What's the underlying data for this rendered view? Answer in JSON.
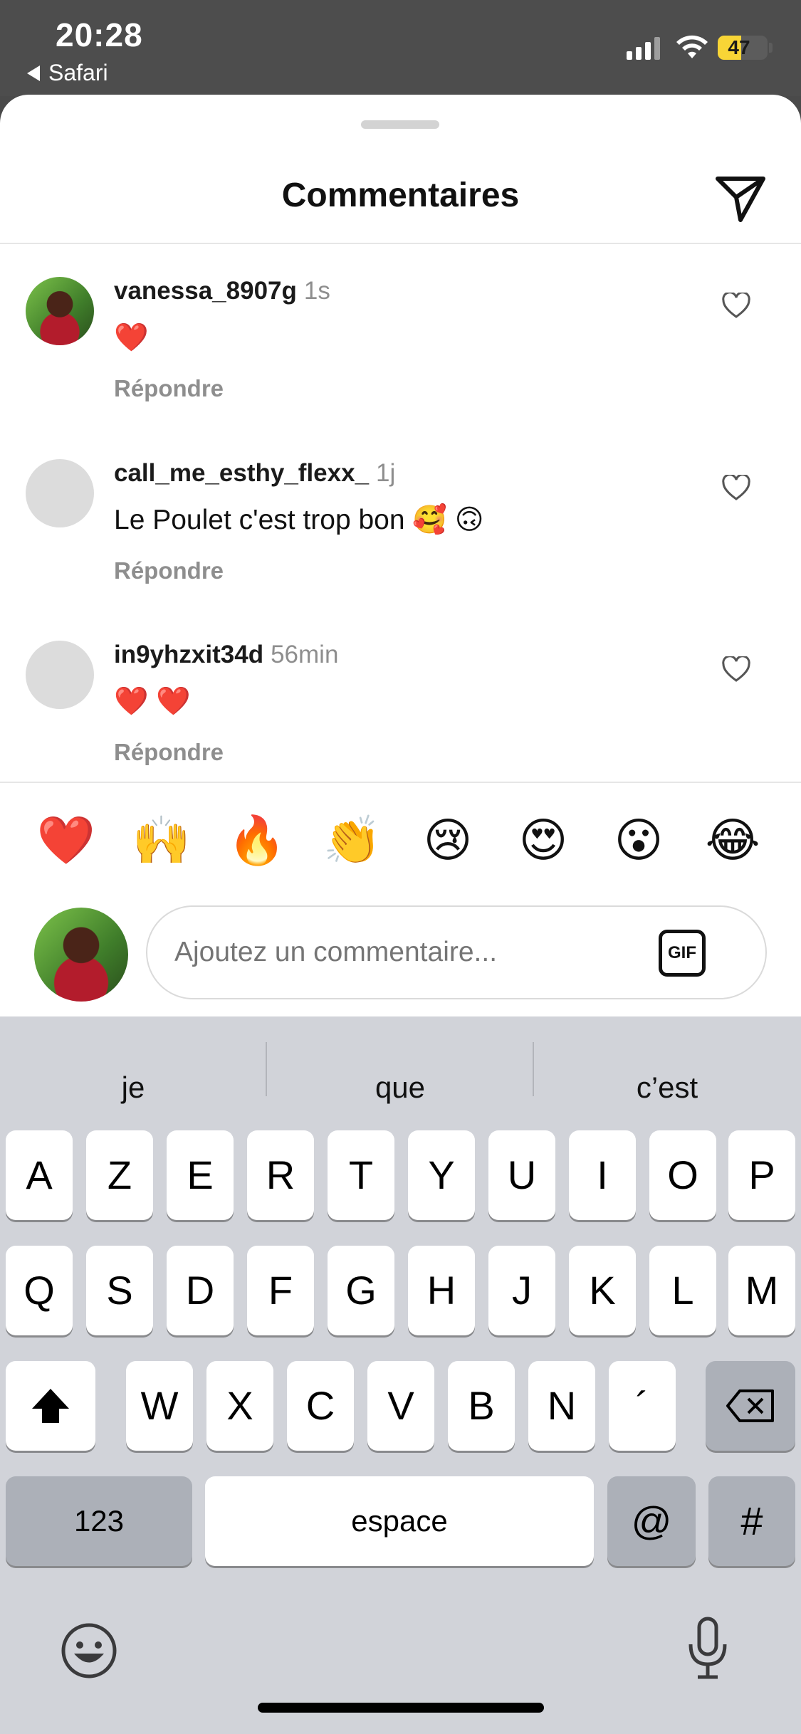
{
  "status_bar": {
    "time": "20:28",
    "back_app": "Safari",
    "battery_percent": "47",
    "battery_level": 0.47
  },
  "sheet": {
    "title": "Commentaires"
  },
  "comments": [
    {
      "username": "vanessa_8907g",
      "time": "1s",
      "text": "❤️",
      "reply_label": "Répondre"
    },
    {
      "username": "call_me_esthy_flexx_",
      "time": "1j",
      "text": "Le Poulet c'est trop bon 🥰 🙃",
      "reply_label": "Répondre"
    },
    {
      "username": "in9yhzxit34d",
      "time": "56min",
      "text": "❤️ ❤️",
      "reply_label": "Répondre"
    }
  ],
  "quick_emojis": [
    "❤️",
    "🙌",
    "🔥",
    "👏",
    "😢",
    "😍",
    "😮",
    "😂"
  ],
  "composer": {
    "placeholder": "Ajoutez un commentaire...",
    "gif_label": "GIF"
  },
  "keyboard": {
    "suggestions": [
      "je",
      "que",
      "c’est"
    ],
    "row1": [
      "A",
      "Z",
      "E",
      "R",
      "T",
      "Y",
      "U",
      "I",
      "O",
      "P"
    ],
    "row2": [
      "Q",
      "S",
      "D",
      "F",
      "G",
      "H",
      "J",
      "K",
      "L",
      "M"
    ],
    "row3": [
      "W",
      "X",
      "C",
      "V",
      "B",
      "N",
      "´"
    ],
    "numbers_key": "123",
    "space_key": "espace",
    "at_key": "@",
    "hash_key": "#"
  },
  "colors": {
    "accent_yellow": "#f8d536",
    "like_red": "#e0202f",
    "muted_text": "#8e8e8e"
  }
}
